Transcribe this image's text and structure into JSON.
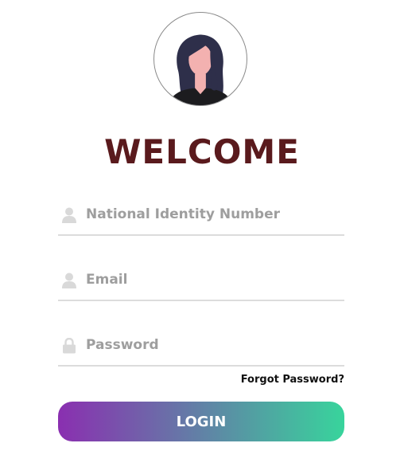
{
  "header": {
    "avatar_icon": "user-avatar-icon",
    "title": "WELCOME"
  },
  "form": {
    "national_id": {
      "placeholder": "National Identity Number",
      "value": "",
      "icon": "user-icon"
    },
    "email": {
      "placeholder": "Email",
      "value": "",
      "icon": "user-icon"
    },
    "password": {
      "placeholder": "Password",
      "value": "",
      "icon": "lock-icon"
    },
    "forgot_password_label": "Forgot Password?",
    "login_label": "LOGIN"
  },
  "colors": {
    "title": "#5a1a1d",
    "button_gradient_start": "#8a2fb0",
    "button_gradient_end": "#38d49c",
    "field_icon": "#d9d9d9"
  }
}
